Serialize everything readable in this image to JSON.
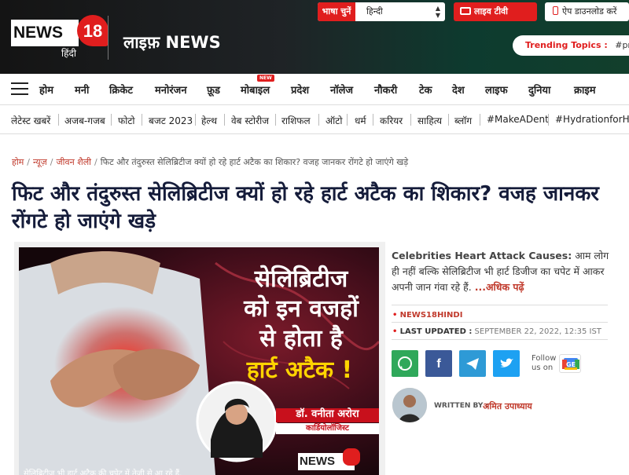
{
  "header": {
    "logo_text": "NEWS",
    "logo_number": "18",
    "logo_sub": "हिंदी",
    "brand_title": "लाइफ़ NEWS",
    "language_label": "भाषा चुनें",
    "language_value": "हिन्दी",
    "live_tv_label": "लाइव टीवी",
    "app_download_label": "ऐप डाउनलोड करें",
    "trending_label": "Trending Topics :",
    "trending_first": "#pm-m"
  },
  "nav": {
    "items": [
      "होम",
      "मनी",
      "क्रिकेट",
      "मनोरंजन",
      "फ़ूड",
      "मोबाइल",
      "प्रदेश",
      "नॉलेज",
      "नौकरी",
      "टेक",
      "देश",
      "लाइफ",
      "दुनिया",
      "क्राइम"
    ],
    "new_badge": "NEW"
  },
  "subnav": {
    "items": [
      "लेटेस्ट खबरें",
      "अजब-गजब",
      "फोटो",
      "बजट 2023",
      "हेल्थ",
      "वेब स्टोरीज",
      "राशिफल",
      "ऑटो",
      "धर्म",
      "करियर",
      "साहित्य",
      "ब्लॉग",
      "#MakeADent",
      "#HydrationforHea"
    ]
  },
  "breadcrumb": {
    "items": [
      "होम",
      "न्यूज़",
      "जीवन शैली"
    ],
    "current": "फिट और तंदुरुस्त सेलिब्रिटीज क्यों हो रहे हार्ट अटैक का शिकार? वजह जानकर रोंगटे हो जाएंगे खड़े"
  },
  "article": {
    "headline": "फिट और तंदुरुस्त सेलिब्रिटीज क्यों हो रहे हार्ट अटैक का शिकार? वजह जानकर रोंगटे हो जाएंगे खड़े",
    "image_text_line1": "सेलिब्रिटीज",
    "image_text_line2": "को इन वजहों",
    "image_text_line3": "से होता है",
    "image_text_line4": "हार्ट अटैक !",
    "doctor_name": "डॉ. वनीता अरोरा",
    "doctor_title": "कार्डियोलॉजिस्ट",
    "image_caption": "सेलिब्रिटीज भी हार्ट अटैक की चपेट में तेजी से आ रहे हैं.",
    "summary_lead": "Celebrities Heart Attack Causes:",
    "summary_text": "आम लोग ही नहीं बल्कि सेलिब्रिटीज भी हार्ट डिजीज का चपेट में आकर अपनी जान गंवा रहे हैं.",
    "read_more": "...अधिक पढ़ें",
    "source": "NEWS18HINDI",
    "last_updated_label": "LAST UPDATED :",
    "last_updated_value": "SEPTEMBER 22, 2022, 12:35 IST",
    "follow_label_1": "Follow",
    "follow_label_2": "us on",
    "written_by_label": "WRITTEN BY :",
    "author": "अमित उपाध्याय"
  },
  "share_buttons": [
    {
      "name": "whatsapp",
      "color": "#2fa85a"
    },
    {
      "name": "facebook",
      "color": "#3b5998"
    },
    {
      "name": "telegram",
      "color": "#2e9ad6"
    },
    {
      "name": "twitter",
      "color": "#1da1f2"
    }
  ],
  "colors": {
    "accent": "#e01e1e",
    "headline": "#151c3a",
    "link": "#c0392b"
  }
}
